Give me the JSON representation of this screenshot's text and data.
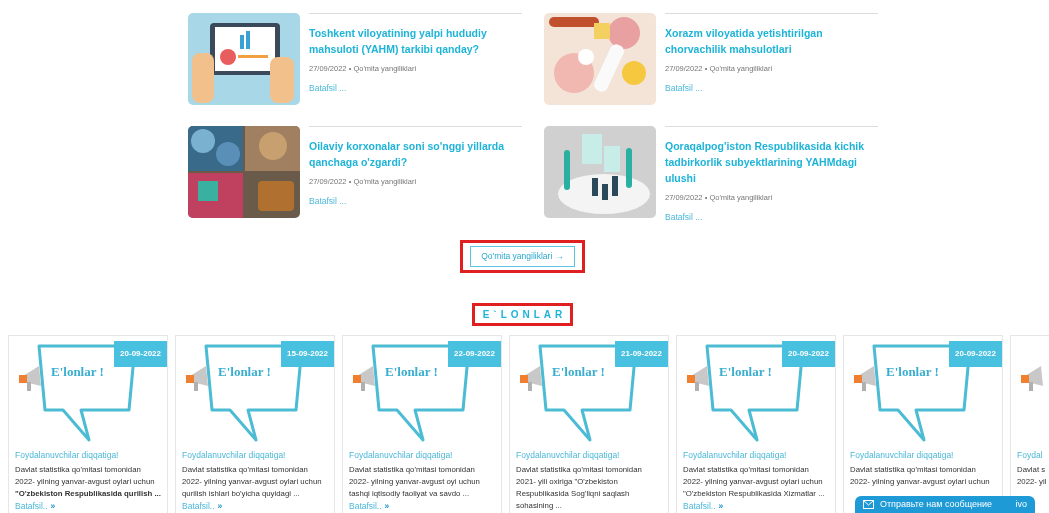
{
  "news": [
    {
      "title": "Toshkent viloyatining yalpi hududiy mahsuloti (YAHM) tarkibi qanday?",
      "date": "27/09/2022",
      "category": "Qo'mita yangiliklari",
      "more": "Batafsil ..."
    },
    {
      "title": "Xorazm viloyatida yetishtirilgan chorvachilik mahsulotlari",
      "date": "27/09/2022",
      "category": "Qo'mita yangiliklari",
      "more": "Batafsil ..."
    },
    {
      "title": "Oilaviy korxonalar soni so'nggi yillarda qanchaga o'zgardi?",
      "date": "27/09/2022",
      "category": "Qo'mita yangiliklari",
      "more": "Batafsil ..."
    },
    {
      "title": "Qoraqalpog'iston Respublikasida kichik tadbirkorlik subyektlarining YAHMdagi ulushi",
      "date": "27/09/2022",
      "category": "Qo'mita yangiliklari",
      "more": "Batafsil ..."
    }
  ],
  "meta_separator": "•",
  "news_button": {
    "label": "Qo'mita yangiliklari",
    "arrow": "→"
  },
  "section_title": "E`LONLAR",
  "announcements": [
    {
      "date": "20-09-2022",
      "banner": "E'lonlar !",
      "category": "Foydalanuvchilar diqqatiga!",
      "lines": [
        "Davlat statistika qo'mitasi tomonidan",
        "2022- yilning yanvar-avgust oylari uchun",
        "**\"O'zbekiston Respublikasida qurilish ...**"
      ],
      "more": "Batafsil..",
      "more_icon": "»"
    },
    {
      "date": "15-09-2022",
      "banner": "E'lonlar !",
      "category": "Foydalanuvchilar diqqatiga!",
      "lines": [
        "Davlat statistika qo'mitasi tomonidan",
        "2022- yilning yanvar-avgust oylari uchun",
        "qurilish ishlari bo'yicha quyidagi ..."
      ],
      "more": "Batafsil..",
      "more_icon": "»"
    },
    {
      "date": "22-09-2022",
      "banner": "E'lonlar !",
      "category": "Foydalanuvchilar diqqatiga!",
      "lines": [
        "Davlat statistika qo'mitasi tomonidan",
        "2022- yilning yanvar-avgust oyi uchun",
        "tashqi iqtisodiy faoliyat va savdo ..."
      ],
      "more": "Batafsil..",
      "more_icon": "»"
    },
    {
      "date": "21-09-2022",
      "banner": "E'lonlar !",
      "category": "Foydalanuvchilar diqqatiga!",
      "lines": [
        "Davlat statistika qo'mitasi tomonidan",
        "2021- yili oxiriga \"O'zbekiston",
        "Respublikasida Sog'liqni saqlash",
        "sohasining ..."
      ]
    },
    {
      "date": "20-09-2022",
      "banner": "E'lonlar !",
      "category": "Foydalanuvchilar diqqatiga!",
      "lines": [
        "Davlat statistika qo'mitasi tomonidan",
        "2022- yilning yanvar-avgust oylari uchun",
        "\"O'zbekiston Respublikasida Xizmatlar ..."
      ],
      "more": "Batafsil..",
      "more_icon": "»"
    },
    {
      "date": "20-09-2022",
      "banner": "E'lonlar !",
      "category": "Foydalanuvchilar diqqatiga!",
      "lines": [
        "Davlat statistika qo'mitasi tomonidan",
        "2022- yilning yanvar-avgust oylari uchun"
      ]
    },
    {
      "category": "Foydal",
      "lines": [
        "Davlat s",
        "2022- yil"
      ]
    }
  ],
  "chat_widget": {
    "label": "Отправьте нам сообщение",
    "brand": "ivo"
  }
}
